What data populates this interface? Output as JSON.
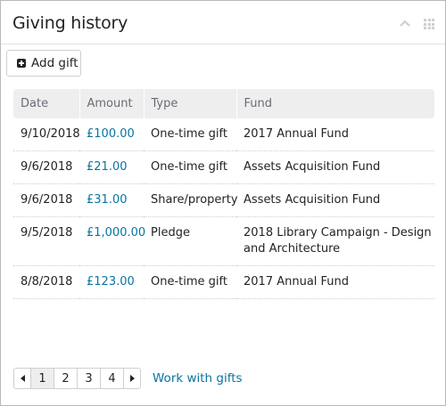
{
  "tile": {
    "title": "Giving history",
    "collapse_icon": "chevron-up-icon",
    "move_icon": "grip-icon"
  },
  "toolbar": {
    "add_gift_label": "Add gift",
    "add_gift_icon": "plus-square-icon"
  },
  "table": {
    "columns": [
      "Date",
      "Amount",
      "Type",
      "Fund"
    ],
    "rows": [
      {
        "date": "9/10/2018",
        "amount": "£100.00",
        "type": "One-time gift",
        "fund": "2017 Annual Fund"
      },
      {
        "date": "9/6/2018",
        "amount": "£21.00",
        "type": "One-time gift",
        "fund": "Assets Acquisition Fund"
      },
      {
        "date": "9/6/2018",
        "amount": "£31.00",
        "type": "Share/property",
        "fund": "Assets Acquisition Fund"
      },
      {
        "date": "9/5/2018",
        "amount": "£1,000.00",
        "type": "Pledge",
        "fund": "2018 Library Campaign - Design and Architecture"
      },
      {
        "date": "8/8/2018",
        "amount": "£123.00",
        "type": "One-time gift",
        "fund": "2017 Annual Fund"
      }
    ]
  },
  "pagination": {
    "pages": [
      "1",
      "2",
      "3",
      "4"
    ],
    "current_page": "1",
    "prev_icon": "caret-left-icon",
    "next_icon": "caret-right-icon"
  },
  "footer": {
    "work_with_gifts_label": "Work with gifts"
  },
  "colors": {
    "link": "#0974a1",
    "header_bg": "#eeeeef"
  }
}
